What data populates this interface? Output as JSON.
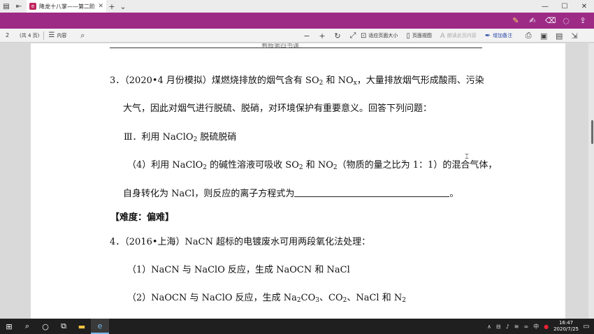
{
  "tab": {
    "title": "降龙十八掌——第二阶("
  },
  "ribbon_icons": [
    "highlighter-icon",
    "text-highlight-icon",
    "eraser-icon",
    "lasso-icon",
    "share-icon"
  ],
  "toolbar": {
    "page_number": "2",
    "page_count": "(共 4 页)",
    "contents_label": "内容",
    "fit_page_label": "适应页面大小",
    "page_view_label": "页面视图",
    "read_aloud_label": "朗读此页内容",
    "add_note_label": "增加备注"
  },
  "document": {
    "header_text": "看腾第四书课",
    "q3_line1": "3．（2020•4 月份模拟）煤燃烧排放的烟气含有 SO",
    "q3_line1_sub1": "2",
    "q3_line1_mid": " 和 NO",
    "q3_line1_sub2": "x",
    "q3_line1_end": "，大量排放烟气形成酸雨、污染",
    "q3_line2": "大气，因此对烟气进行脱硫、脱硝，对环境保护有重要意义。回答下列问题：",
    "q3_line3_a": "Ⅲ．利用 NaClO",
    "q3_line3_sub": "2",
    "q3_line3_b": " 脱硫脱硝",
    "q3_line4_a": "（4）利用 NaClO",
    "q3_line4_sub1": "2",
    "q3_line4_b": " 的碱性溶液可吸收 SO",
    "q3_line4_sub2": "2",
    "q3_line4_c": " 和 NO",
    "q3_line4_sub3": "2",
    "q3_line4_d": "（物质的量之比为 1：1）的混合气体，",
    "q3_line5_a": "自身转化为 NaCl，则反应的离子方程式为",
    "q3_line5_b": "。",
    "difficulty": "【难度：偏难】",
    "q4_line1": "4．（2016•上海）NaCN 超标的电镀废水可用两段氧化法处理：",
    "q4_line2": "（1）NaCN 与 NaClO 反应，生成 NaOCN 和 NaCl",
    "q4_line3_a": "（2）NaOCN 与 NaClO 反应，生成 Na",
    "q4_line3_sub1": "2",
    "q4_line3_b": "CO",
    "q4_line3_sub2": "3",
    "q4_line3_c": "、CO",
    "q4_line3_sub3": "2",
    "q4_line3_d": "、NaCl 和 N",
    "q4_line3_sub4": "2"
  },
  "taskbar": {
    "ime": "中",
    "time": "16:47",
    "date": "2020/7/25"
  }
}
